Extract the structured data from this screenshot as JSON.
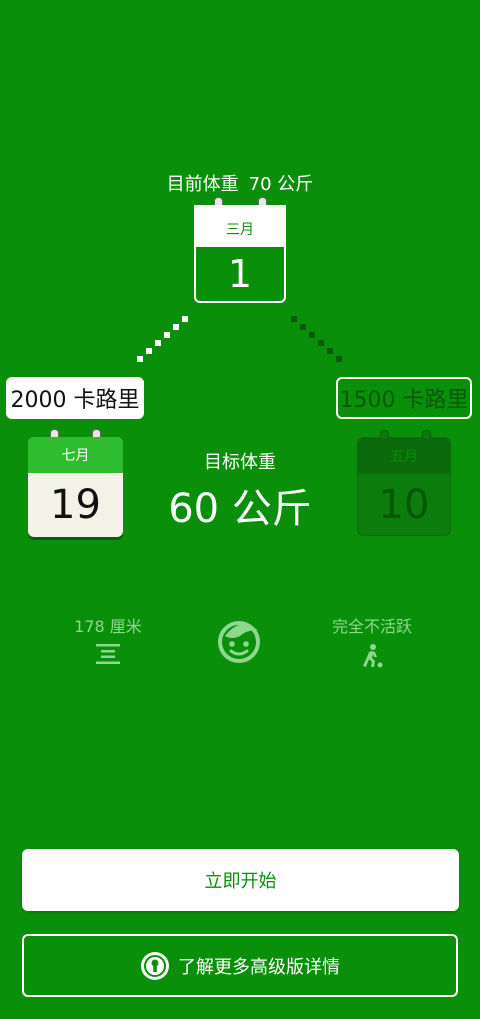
{
  "current_weight": {
    "label": "目前体重",
    "value": "70 公斤"
  },
  "start_calendar": {
    "month": "三月",
    "day": "1"
  },
  "left_plan": {
    "calories": "2000 卡路里",
    "month": "七月",
    "day": "19"
  },
  "right_plan": {
    "calories": "1500 卡路里",
    "month": "五月",
    "day": "10"
  },
  "goal": {
    "label": "目标体重",
    "value": "60 公斤"
  },
  "stats": {
    "height": "178 厘米",
    "activity": "完全不活跃"
  },
  "icons": [
    "height-icon",
    "avatar-icon",
    "activity-icon",
    "keyhole-badge-icon"
  ],
  "buttons": {
    "start": "立即开始",
    "premium": "了解更多高级版详情"
  },
  "colors": {
    "background": "#0a8f0a",
    "accent_light": "#2ebd2e",
    "muted": "#8fd68f"
  }
}
